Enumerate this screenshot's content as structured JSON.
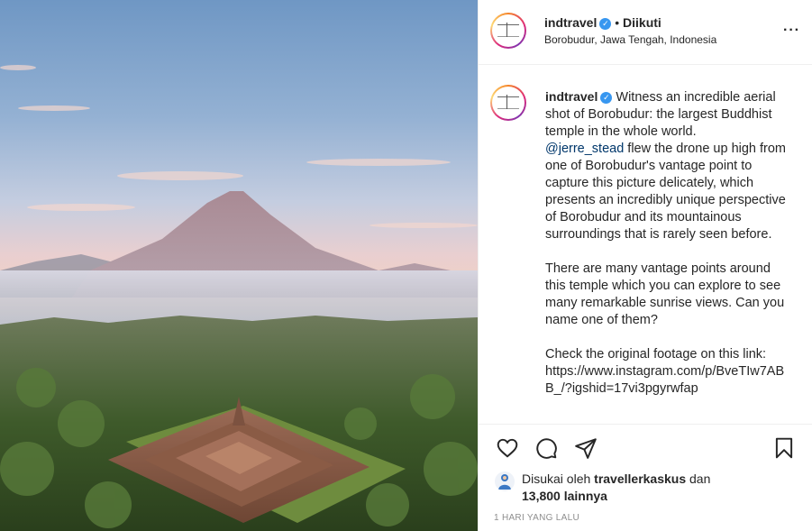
{
  "post": {
    "photo": {
      "alt": "Borobudur temple with mountain at sunrise"
    },
    "header": {
      "username": "indtravel",
      "verified": true,
      "separator": "•",
      "follow_status": "Diikuti",
      "location": "Borobudur, Jawa Tengah, Indonesia",
      "more_icon": "more-horizontal-icon"
    },
    "caption": {
      "username": "indtravel",
      "text_part1": " Witness an incredible aerial shot of Borobudur: the largest Buddhist temple in the whole world.\n",
      "mention": "@jerre_stead",
      "text_part2": " flew the drone up high from one of Borobudur's vantage point to capture this picture delicately, which presents an incredibly unique perspective of Borobudur and its mountainous surroundings that is rarely seen before.\n\nThere are many vantage points around this temple which you can explore to see many remarkable sunrise views. Can you name one of them?\n\nCheck the original footage on this link: https://www.instagram.com/p/BveTIw7ABB_/?igshid=17vi3pgyrwfap"
    },
    "actions": {
      "like_icon": "heart-icon",
      "comment_icon": "comment-icon",
      "share_icon": "share-icon",
      "save_icon": "bookmark-icon"
    },
    "likes": {
      "prefix": "Disukai oleh ",
      "liker": "travellerkaskus",
      "conj": " dan",
      "others": "13,800 lainnya"
    },
    "time_ago": "1 HARI YANG LALU"
  },
  "colors": {
    "verified": "#3897f0",
    "mention": "#00376b",
    "muted": "#8e8e8e"
  }
}
